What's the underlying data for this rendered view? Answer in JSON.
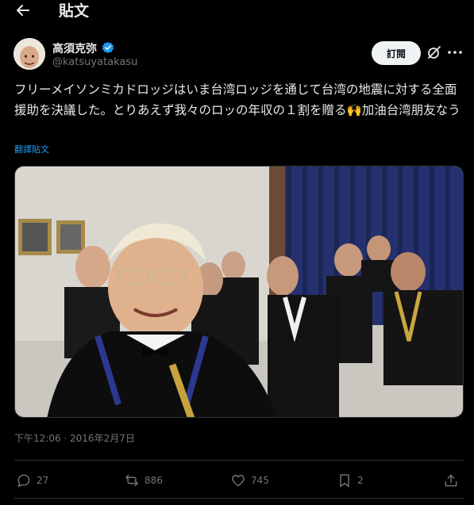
{
  "header": {
    "back_icon": "arrow-left-icon",
    "title": "貼文"
  },
  "author": {
    "name": "高須克弥",
    "handle": "@katsuyatakasu",
    "verified_icon": "verified-badge-icon",
    "verified_color": "#1d9bf0"
  },
  "follow_button": {
    "label": "訂閱"
  },
  "grok_icon": "grok-icon",
  "more_icon": "more-horizontal-icon",
  "tweet": {
    "text": "フリーメイソンミカドロッジはいま台湾ロッジを通じて台湾の地震に対する全面援助を決議した。とりあえず我々のロッの年収の１割を贈る🙌加油台湾朋友なう",
    "translate_label": "翻譯貼文"
  },
  "media": {
    "kind": "photo"
  },
  "meta": {
    "timestamp": "下午12:06 · 2016年2月7日"
  },
  "actions": {
    "reply": {
      "icon": "reply-icon",
      "count": "27"
    },
    "repost": {
      "icon": "repost-icon",
      "count": "886"
    },
    "like": {
      "icon": "heart-icon",
      "count": "745"
    },
    "bookmark": {
      "icon": "bookmark-icon",
      "count": "2"
    },
    "share": {
      "icon": "share-icon"
    }
  },
  "colors": {
    "background": "#000000",
    "text": "#e7e9ea",
    "muted": "#71767b",
    "link": "#1d9bf0",
    "border": "#2f3336"
  }
}
